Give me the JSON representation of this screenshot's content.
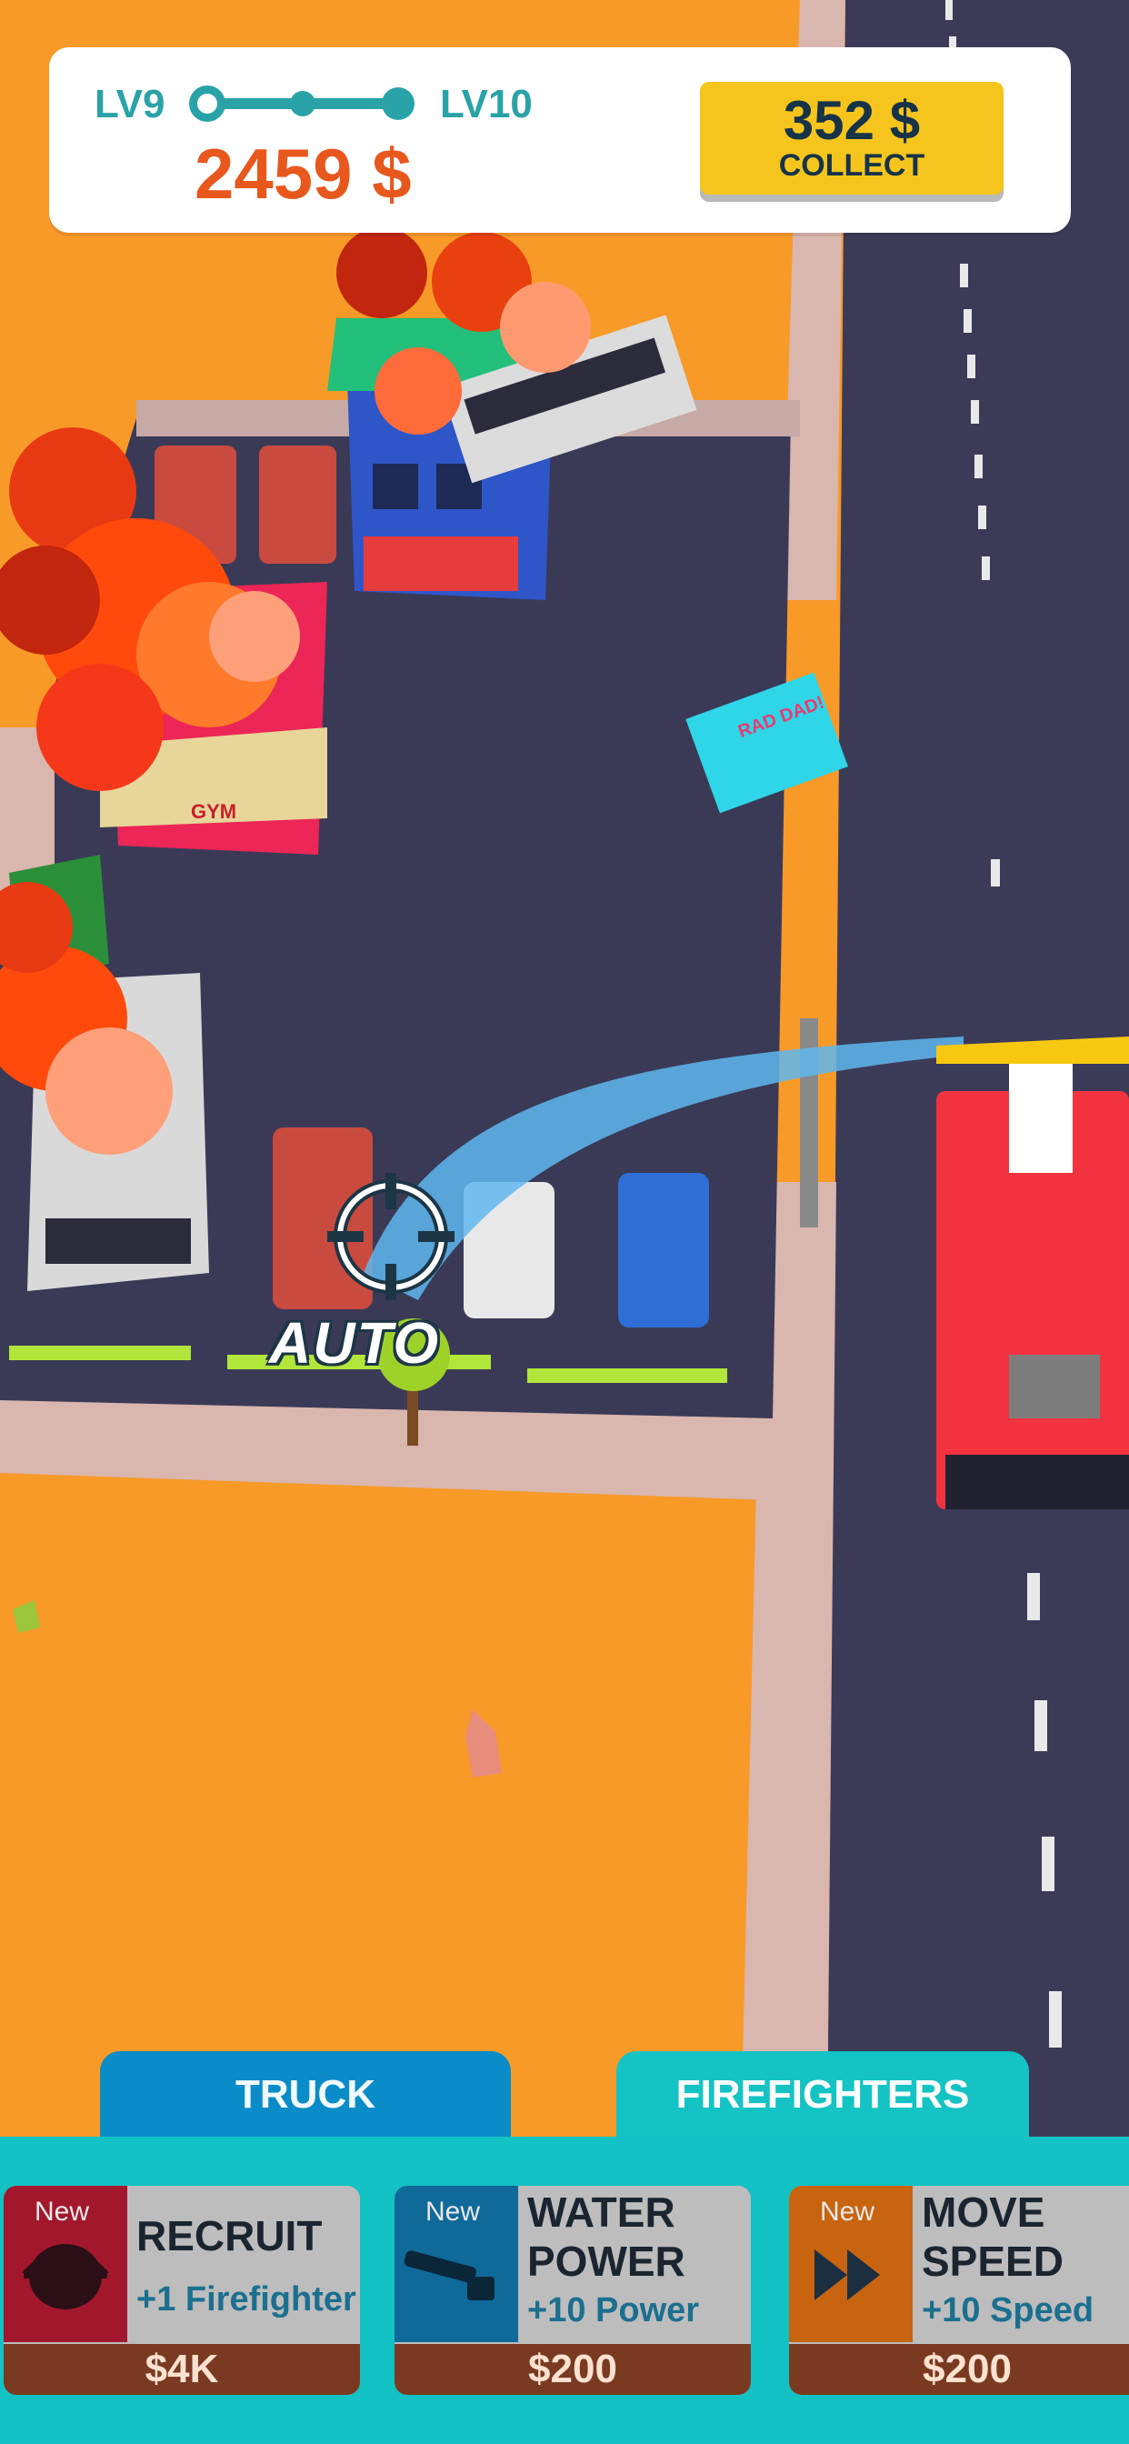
{
  "hud": {
    "level_current": "LV9",
    "level_next": "LV10",
    "level_progress": 0.5,
    "money": "2459 $",
    "collect_amount": "352 $",
    "collect_label": "COLLECT"
  },
  "scene": {
    "billboard_text": "RAD DAD!",
    "gym_sign": "GYM",
    "auto_label": "AUTO"
  },
  "tabs": [
    {
      "label": "TRUCK",
      "active": false
    },
    {
      "label": "FIREFIGHTERS",
      "active": true
    }
  ],
  "upgrades": [
    {
      "badge": "New",
      "title": "RECRUIT",
      "subtitle": "+1 Firefighter",
      "price": "$4K",
      "icon": "firefighter-helmet-icon",
      "accent": "#a3172c",
      "price_bg": "#7a3a22",
      "sub_color": "#1b6f8f"
    },
    {
      "badge": "New",
      "title": "WATER\nPOWER",
      "subtitle": "+10 Power",
      "price": "$200",
      "icon": "water-hose-icon",
      "accent": "#0f6a9a",
      "price_bg": "#7a3a22",
      "sub_color": "#1b6f8f"
    },
    {
      "badge": "New",
      "title": "MOVE\nSPEED",
      "subtitle": "+10 Speed",
      "price": "$200",
      "icon": "fast-forward-icon",
      "accent": "#c86410",
      "price_bg": "#7a3a22",
      "sub_color": "#1b6f8f"
    }
  ],
  "colors": {
    "ground": "#f89a28",
    "road": "#3a3a55",
    "accent": "#2aa3a8",
    "money": "#e8581d",
    "collect_button": "#f5c51d",
    "panel": "#12c2c4"
  }
}
